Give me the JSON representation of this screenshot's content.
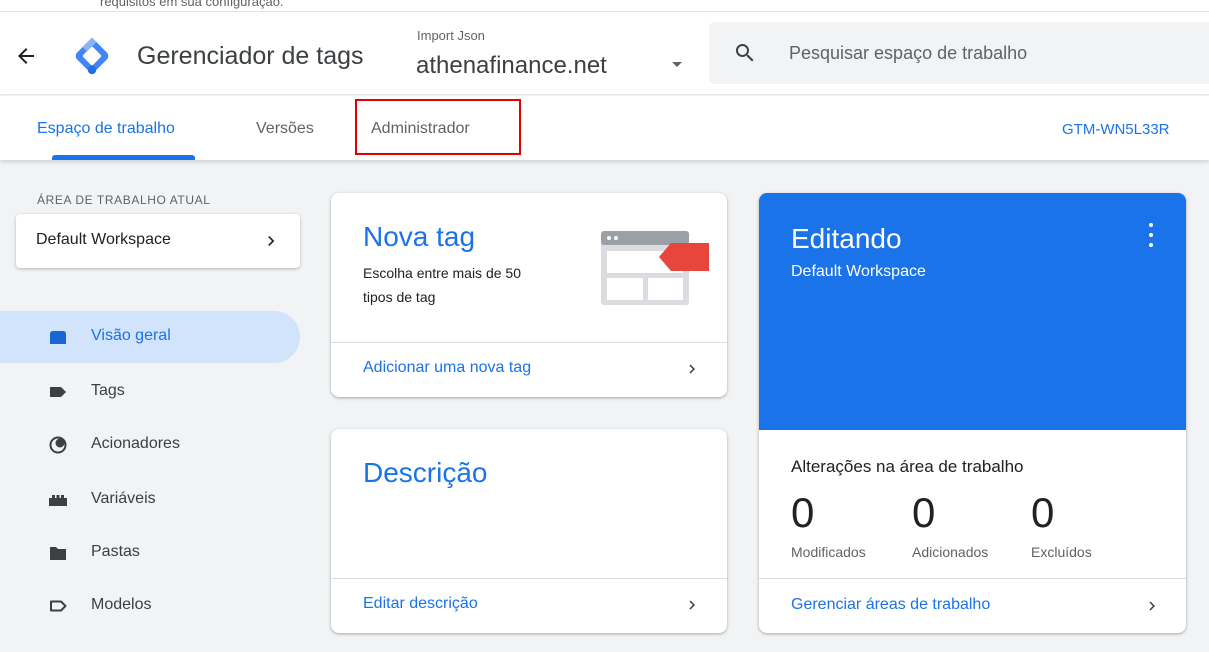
{
  "header": {
    "top_strip_text": "requisitos em sua configuração.",
    "app_title": "Gerenciador de tags",
    "container_subtitle": "Import Json",
    "container_name": "athenafinance.net",
    "search_placeholder": "Pesquisar espaço de trabalho"
  },
  "tabs": [
    {
      "label": "Espaço de trabalho",
      "active": true
    },
    {
      "label": "Versões",
      "active": false
    },
    {
      "label": "Administrador",
      "active": false,
      "highlighted": true
    }
  ],
  "container_id": "GTM-WN5L33R",
  "sidebar": {
    "workspace_label": "ÁREA DE TRABALHO ATUAL",
    "workspace_name": "Default Workspace",
    "items": [
      {
        "label": "Visão geral",
        "icon": "overview-icon",
        "active": true
      },
      {
        "label": "Tags",
        "icon": "tag-icon",
        "active": false
      },
      {
        "label": "Acionadores",
        "icon": "trigger-icon",
        "active": false
      },
      {
        "label": "Variáveis",
        "icon": "variables-icon",
        "active": false
      },
      {
        "label": "Pastas",
        "icon": "folder-icon",
        "active": false
      },
      {
        "label": "Modelos",
        "icon": "template-icon",
        "active": false
      }
    ]
  },
  "new_tag_card": {
    "title": "Nova tag",
    "description": "Escolha entre mais de 50 tipos de tag",
    "link": "Adicionar uma nova tag"
  },
  "description_card": {
    "title": "Descrição",
    "link": "Editar descrição"
  },
  "editing_card": {
    "title": "Editando",
    "subtitle": "Default Workspace",
    "changes_label": "Alterações na área de trabalho",
    "stats": [
      {
        "value": "0",
        "label": "Modificados"
      },
      {
        "value": "0",
        "label": "Adicionados"
      },
      {
        "value": "0",
        "label": "Excluídos"
      }
    ],
    "link": "Gerenciar áreas de trabalho"
  },
  "colors": {
    "accent": "#1a73e8",
    "active_nav_bg": "#d2e3fc",
    "highlight_border": "#e50000",
    "tag_illustration_red": "#e8453c"
  }
}
